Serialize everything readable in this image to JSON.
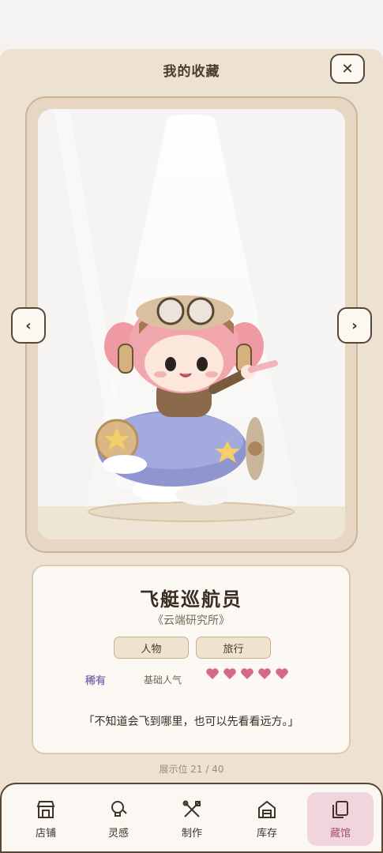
{
  "header": {
    "title": "我的收藏",
    "close_icon": "close-icon"
  },
  "showcase": {
    "prev_icon": "chevron-left-icon",
    "next_icon": "chevron-right-icon",
    "figure": "pink-haired pilot figurine riding a blue airship"
  },
  "item": {
    "name": "飞艇巡航员",
    "series": "《云端研究所》",
    "tags": [
      "人物",
      "旅行"
    ],
    "rarity": "稀有",
    "popularity_label": "基础人气",
    "popularity_hearts": 5,
    "quote": "「不知道会飞到哪里，也可以先看看远方。」"
  },
  "slot_text": "展示位 21 / 40",
  "nav": {
    "items": [
      {
        "label": "店铺",
        "icon": "shop-icon",
        "active": false
      },
      {
        "label": "灵感",
        "icon": "lightbulb-icon",
        "active": false
      },
      {
        "label": "制作",
        "icon": "tools-icon",
        "active": false
      },
      {
        "label": "库存",
        "icon": "warehouse-icon",
        "active": false
      },
      {
        "label": "藏馆",
        "icon": "collection-icon",
        "active": true
      }
    ]
  },
  "colors": {
    "panel_bg": "#ede1d2",
    "accent_pink": "#d56a86",
    "rarity_purple": "#8b74b6",
    "active_nav_bg": "#f0d6dc",
    "border_brown": "#5a4634"
  }
}
